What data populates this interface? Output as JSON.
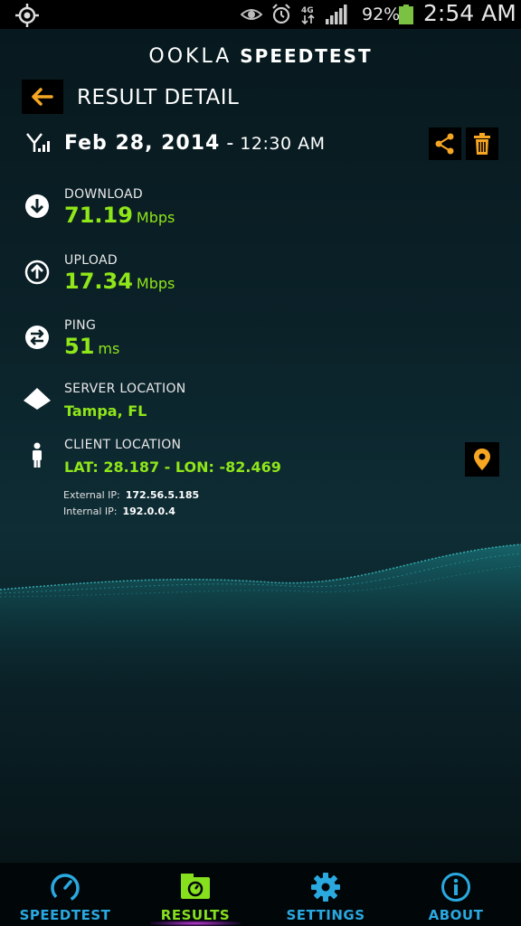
{
  "status_bar": {
    "battery_percent": "92%",
    "time": "2:54 AM",
    "icons": [
      "gps-icon",
      "eye-icon",
      "alarm-icon",
      "4g-icon",
      "signal-icon",
      "battery-icon"
    ],
    "battery_level": 0.92
  },
  "brand": {
    "ookla": "OOKLA",
    "speedtest": "SPEEDTEST"
  },
  "header": {
    "title": "RESULT DETAIL"
  },
  "result": {
    "date": "Feb 28, 2014",
    "separator": "-",
    "time": "12:30 AM",
    "download": {
      "label": "DOWNLOAD",
      "value": "71.19",
      "unit": "Mbps"
    },
    "upload": {
      "label": "UPLOAD",
      "value": "17.34",
      "unit": "Mbps"
    },
    "ping": {
      "label": "PING",
      "value": "51",
      "unit": "ms"
    },
    "server": {
      "label": "SERVER LOCATION",
      "value": "Tampa, FL"
    },
    "client": {
      "label": "CLIENT LOCATION",
      "value": "LAT: 28.187 - LON: -82.469"
    },
    "external_ip": {
      "label": "External IP:",
      "value": "172.56.5.185"
    },
    "internal_ip": {
      "label": "Internal IP:",
      "value": "192.0.0.4"
    }
  },
  "nav": {
    "tabs": [
      {
        "label": "SPEEDTEST",
        "active": false
      },
      {
        "label": "RESULTS",
        "active": true
      },
      {
        "label": "SETTINGS",
        "active": false
      },
      {
        "label": "ABOUT",
        "active": false
      }
    ]
  },
  "colors": {
    "accent_orange": "#f6a623",
    "value_green": "#8fe619",
    "nav_blue": "#2aa9e0",
    "nav_active_green": "#86e01e"
  }
}
